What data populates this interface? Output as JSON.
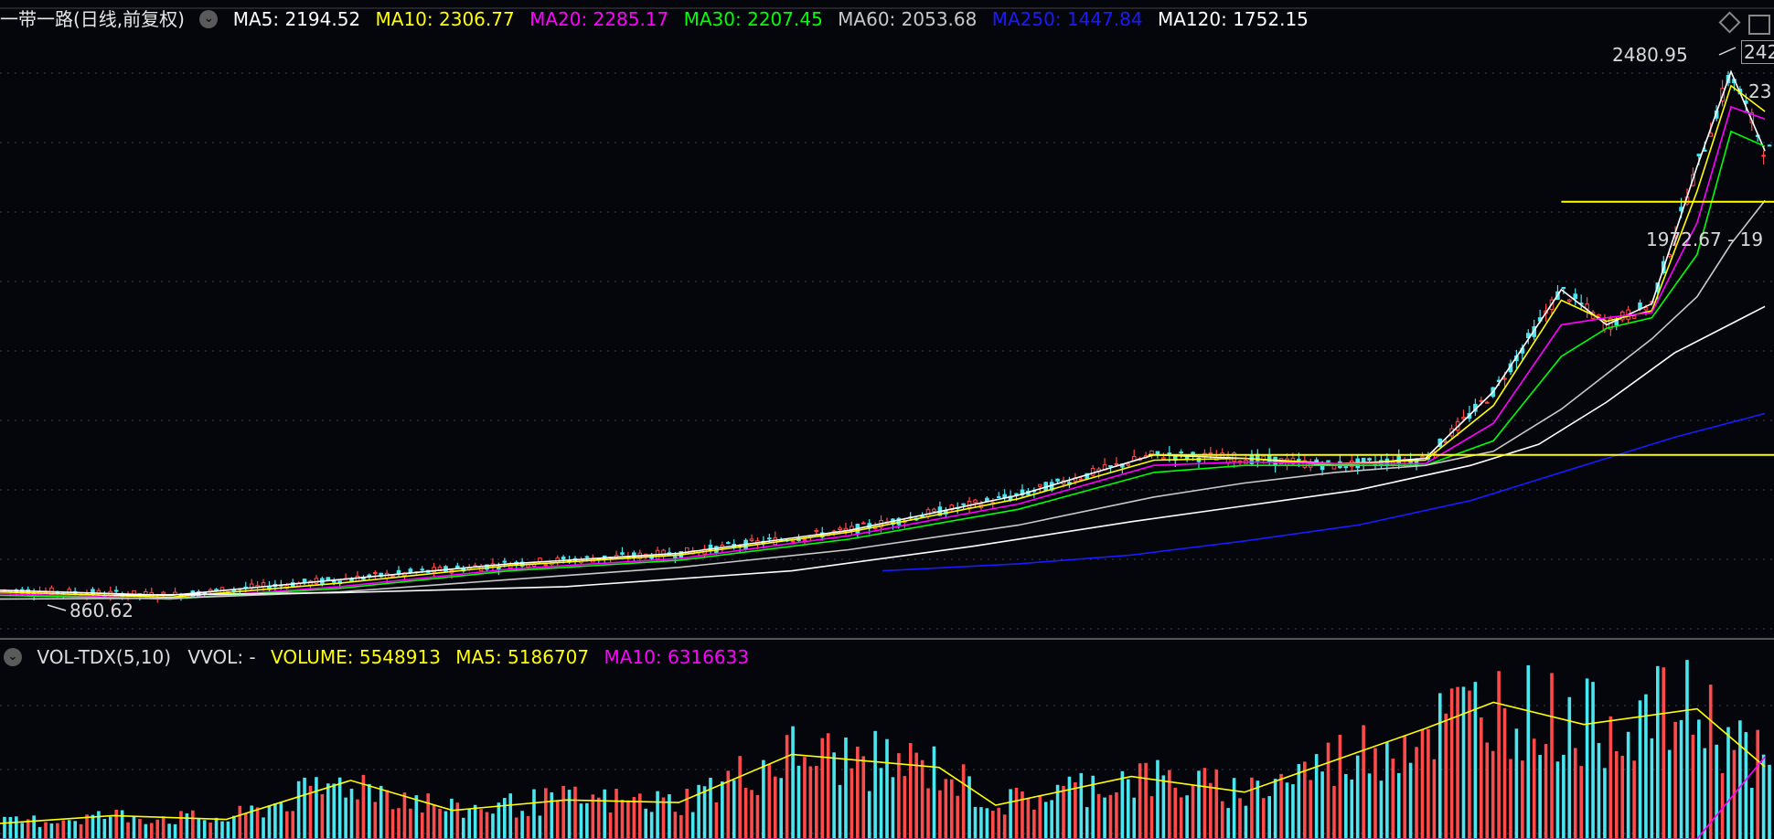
{
  "header": {
    "title": "一带一路(日线,前复权)",
    "ma": [
      {
        "label": "MA5: 2194.52",
        "color": "#ffffff"
      },
      {
        "label": "MA10: 2306.77",
        "color": "#ffff00"
      },
      {
        "label": "MA20: 2285.17",
        "color": "#ff00ff"
      },
      {
        "label": "MA30: 2207.45",
        "color": "#00ff00"
      },
      {
        "label": "MA60: 2053.68",
        "color": "#c8c8c8"
      },
      {
        "label": "MA250: 1447.84",
        "color": "#1a1aff"
      },
      {
        "label": "MA120: 1752.15",
        "color": "#ffffff"
      }
    ]
  },
  "volume_header": {
    "indicator": "VOL-TDX(5,10)",
    "vvol": "VVOL: -",
    "volume": "VOLUME: 5548913",
    "ma5": "MA5: 5186707",
    "ma10": "MA10: 6316633"
  },
  "annotations": {
    "high_label": "2480.95",
    "high_side_label": "242",
    "low_label": "860.62",
    "support_label": "1972.67 - 19",
    "right_edge_label": "23"
  },
  "colors": {
    "background": "#05050c",
    "up": "#ff4a4a",
    "down": "#4ae6f0",
    "grid": "#3a3a55",
    "volume_ma5": "#ffff00",
    "volume_ma10": "#ff00ff",
    "trendline": "#ffff00"
  },
  "chart_data": {
    "type": "line",
    "title": "一带一路(日线,前复权)",
    "series": [
      {
        "name": "MA5",
        "color": "#ffffff",
        "x": [
          0,
          150,
          300,
          450,
          600,
          750,
          900,
          1020,
          1100,
          1180,
          1260,
          1320,
          1380,
          1420,
          1460,
          1500,
          1530,
          1560
        ],
        "values": [
          945,
          930,
          975,
          1020,
          1050,
          1115,
          1215,
          1330,
          1320,
          1300,
          1320,
          1510,
          1800,
          1700,
          1760,
          2150,
          2420,
          2194.52
        ]
      },
      {
        "name": "MA10",
        "color": "#ffff00",
        "x": [
          0,
          150,
          300,
          450,
          600,
          750,
          900,
          1020,
          1100,
          1180,
          1260,
          1320,
          1380,
          1420,
          1460,
          1500,
          1530,
          1560
        ],
        "values": [
          940,
          925,
          965,
          1015,
          1045,
          1110,
          1205,
          1315,
          1320,
          1305,
          1315,
          1470,
          1770,
          1710,
          1740,
          2080,
          2380,
          2306.77
        ]
      },
      {
        "name": "MA20",
        "color": "#ff00ff",
        "x": [
          0,
          150,
          300,
          450,
          600,
          750,
          900,
          1020,
          1100,
          1180,
          1260,
          1320,
          1380,
          1420,
          1460,
          1500,
          1530,
          1560
        ],
        "values": [
          935,
          920,
          955,
          1005,
          1035,
          1100,
          1190,
          1300,
          1310,
          1305,
          1305,
          1420,
          1700,
          1720,
          1735,
          1990,
          2320,
          2285.17
        ]
      },
      {
        "name": "MA30",
        "color": "#00ff00",
        "x": [
          0,
          150,
          300,
          450,
          600,
          750,
          900,
          1020,
          1100,
          1180,
          1260,
          1320,
          1380,
          1420,
          1460,
          1500,
          1530,
          1560
        ],
        "values": [
          930,
          920,
          950,
          1000,
          1030,
          1090,
          1175,
          1280,
          1300,
          1300,
          1300,
          1370,
          1610,
          1690,
          1720,
          1900,
          2250,
          2207.45
        ]
      },
      {
        "name": "MA60",
        "color": "#c8c8c8",
        "x": [
          0,
          150,
          300,
          450,
          600,
          750,
          900,
          1020,
          1100,
          1180,
          1260,
          1320,
          1380,
          1420,
          1460,
          1500,
          1530,
          1560
        ],
        "values": [
          920,
          922,
          940,
          975,
          1010,
          1060,
          1130,
          1210,
          1250,
          1280,
          1300,
          1340,
          1460,
          1560,
          1660,
          1780,
          1930,
          2053.68
        ]
      },
      {
        "name": "MA120",
        "color": "#ffffff",
        "x": [
          100,
          300,
          500,
          700,
          860,
          1000,
          1100,
          1200,
          1300,
          1360,
          1420,
          1480,
          1560
        ],
        "values": [
          930,
          938,
          955,
          1000,
          1070,
          1140,
          1185,
          1230,
          1300,
          1360,
          1480,
          1620,
          1752.15
        ]
      },
      {
        "name": "MA250",
        "color": "#1a1aff",
        "x": [
          780,
          900,
          1000,
          1100,
          1200,
          1300,
          1400,
          1480,
          1560
        ],
        "values": [
          1000,
          1020,
          1045,
          1085,
          1130,
          1200,
          1300,
          1380,
          1447.84
        ]
      }
    ],
    "trendlines": [
      {
        "from_x": 1015,
        "to_x": 1568,
        "value": 1330
      },
      {
        "from_x": 1380,
        "to_x": 1568,
        "value": 2050
      }
    ],
    "ylim": [
      830,
      2520
    ],
    "grid": true
  },
  "volume_data": {
    "type": "bar",
    "ylim": [
      0,
      12500000
    ],
    "ma5": [
      1200000,
      1800000,
      1500000,
      4500000,
      2200000,
      3000000,
      2800000,
      6500000,
      5500000,
      2600000,
      4800000,
      3600000,
      8500000,
      10500000,
      8800000,
      10000000,
      5548913
    ],
    "ma5_x": [
      0,
      100,
      200,
      310,
      400,
      500,
      600,
      700,
      830,
      880,
      1000,
      1100,
      1260,
      1320,
      1400,
      1500,
      1560
    ],
    "ma10": [
      1000,
      1500,
      1400,
      3200,
      2400,
      2800,
      2900,
      5000,
      5200,
      3000,
      4500,
      4000,
      7200,
      9000,
      9400,
      9200,
      6316633
    ],
    "ma10_x": [
      0,
      100,
      200,
      310,
      400,
      500,
      600,
      700,
      830,
      880,
      1000,
      1100,
      1260,
      1320,
      1400,
      1500,
      1560
    ]
  }
}
